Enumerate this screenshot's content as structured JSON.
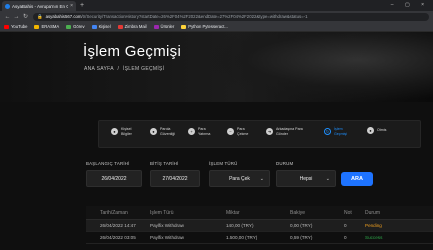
{
  "browser": {
    "tab_title": "AsyaBahis - Avrupa'nın En Güven...",
    "tab_close": "×",
    "new_tab": "+",
    "window_controls": "–  ▢  ×",
    "url_host": "asyabahis567.com",
    "url_path": "/tr/Security/TransactionHistory?startDate=26%2F04%2F2022&endDate=27%2F04%2F2022&type=withdraw&status=-1",
    "bookmarks": [
      {
        "label": "YouTube",
        "color": "#ff0000"
      },
      {
        "label": "ERASMA",
        "color": "#f2b600"
      },
      {
        "label": "Görev",
        "color": "#4caf50"
      },
      {
        "label": "Kişisel",
        "color": "#4285f4"
      },
      {
        "label": "Zimbra Mail",
        "color": "#e53935"
      },
      {
        "label": "Ürünler",
        "color": "#9c27b0"
      },
      {
        "label": "Python Pytesseract...",
        "color": "#ffd43b"
      }
    ]
  },
  "hero": {
    "title": "İşlem Geçmişi",
    "breadcrumb_home": "ANA SAYFA",
    "breadcrumb_sep": "/",
    "breadcrumb_current": "İŞLEM GEÇMİŞİ"
  },
  "menu": [
    {
      "label": "Kişisel\nBilgiler",
      "icon": "user-icon",
      "glyph": "●"
    },
    {
      "label": "Parola\nGüvenliği",
      "icon": "lock-icon",
      "glyph": "●"
    },
    {
      "label": "Para\nYatırma",
      "icon": "deposit-icon",
      "glyph": "+"
    },
    {
      "label": "Para\nÇekme",
      "icon": "withdraw-icon",
      "glyph": "−"
    },
    {
      "label": "Arkadaşına Para\nGönder",
      "icon": "send-money-icon",
      "glyph": "➜"
    },
    {
      "label": "İşlem\nGeçmişi",
      "icon": "history-icon",
      "glyph": "↻",
      "active": true
    },
    {
      "label": "Otmis",
      "icon": "exit-icon",
      "glyph": "●"
    }
  ],
  "filters": {
    "start_label": "BAŞLANGIÇ TARİHİ",
    "end_label": "BİTİŞ TARİHİ",
    "type_label": "İŞLEM TÜRÜ",
    "status_label": "DURUM",
    "start_value": "26/04/2022",
    "end_value": "27/04/2022",
    "type_value": "Para Çek",
    "status_value": "Hepsi",
    "caret": "⌄",
    "search_label": "ARA"
  },
  "table": {
    "headers": [
      "Tarih/Zaman",
      "İşlem Türü",
      "Miktar",
      "Bakiye",
      "Not",
      "Durum"
    ],
    "rows": [
      [
        "26/04/2022 14:47",
        "Paylfix Withdraw",
        "140,00 (TRY)",
        "0,00 (TRY)",
        "0",
        "Pending"
      ],
      [
        "26/04/2022 03:05",
        "Paylfix Withdraw",
        "1.500,00 (TRY)",
        "0,59 (TRY)",
        "0",
        "Success"
      ]
    ]
  },
  "colors": {
    "accent": "#1e73ff",
    "pending": "#f0a020",
    "success": "#2ea84a"
  }
}
